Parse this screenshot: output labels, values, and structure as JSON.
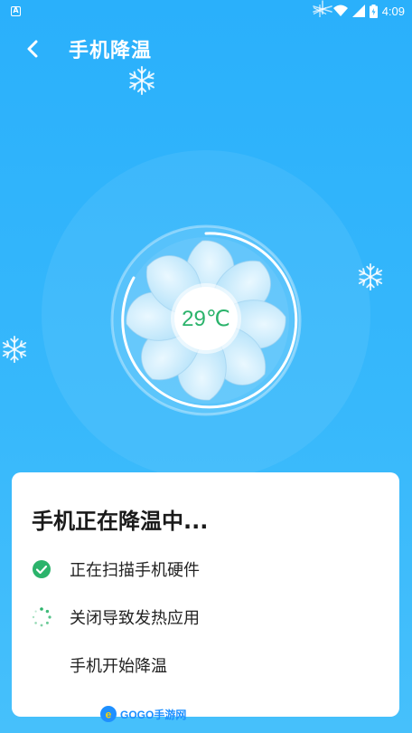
{
  "status_bar": {
    "notification_icon": "a-icon",
    "time": "4:09"
  },
  "header": {
    "title": "手机降温"
  },
  "temperature": {
    "value": "29℃"
  },
  "card": {
    "title": "手机正在降温中...",
    "steps": [
      {
        "label": "正在扫描手机硬件",
        "state": "done"
      },
      {
        "label": "关闭导致发热应用",
        "state": "in-progress"
      },
      {
        "label": "手机开始降温",
        "state": "pending"
      }
    ]
  },
  "watermark": {
    "text": "GOGO手游网"
  },
  "colors": {
    "background": "#2ab0fb",
    "check_green": "#2bb36b",
    "card": "#ffffff"
  }
}
